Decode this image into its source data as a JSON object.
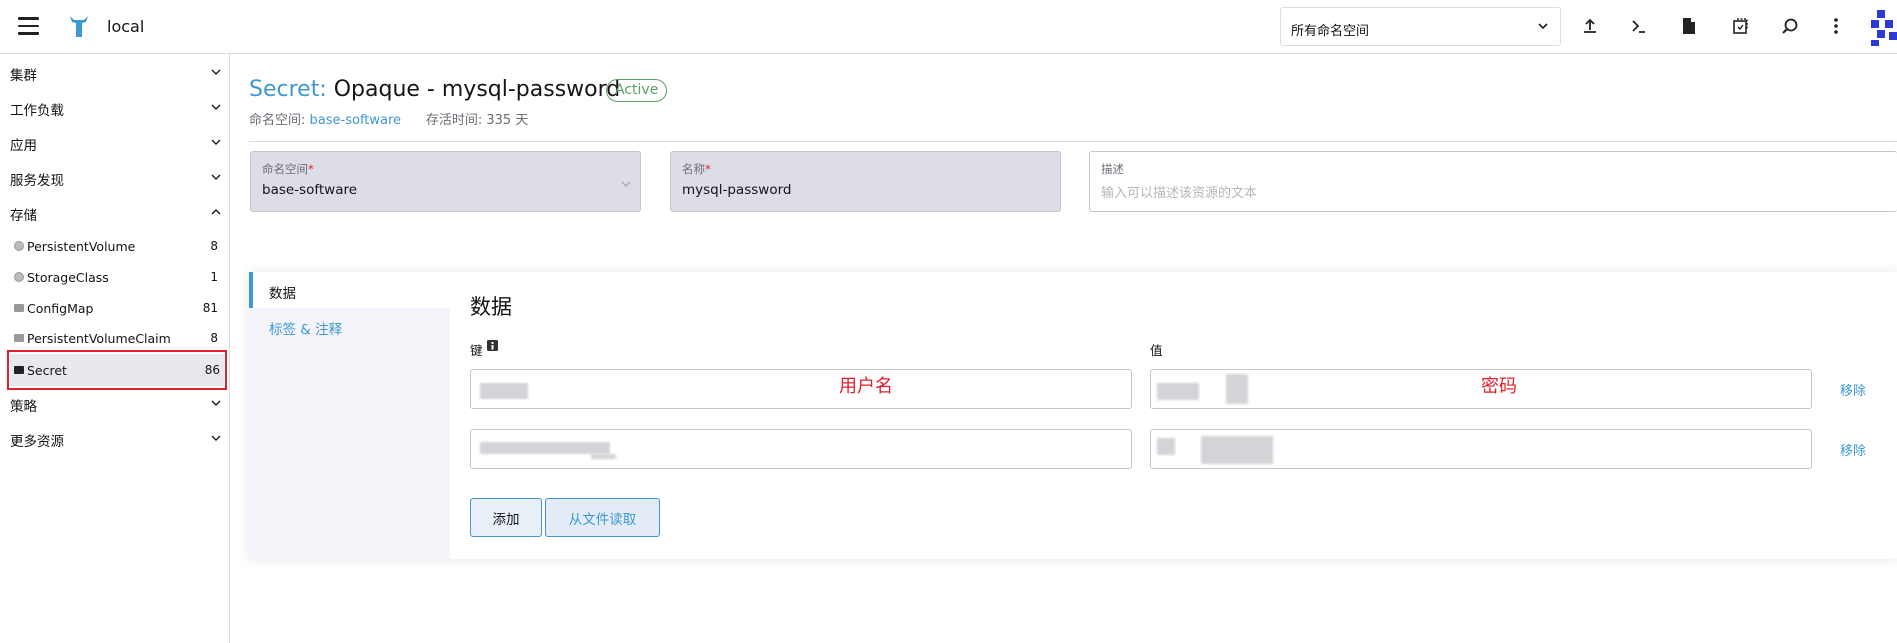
{
  "topbar": {
    "cluster_name": "local",
    "namespace_select": "所有命名空间",
    "icons": [
      "upload-icon",
      "kubectl-shell-icon",
      "file-icon",
      "copy-icon",
      "search-icon",
      "more-vert-icon"
    ]
  },
  "sidebar": {
    "groups": [
      {
        "label": "集群"
      },
      {
        "label": "工作负载"
      },
      {
        "label": "应用"
      },
      {
        "label": "服务发现"
      },
      {
        "label": "存储"
      },
      {
        "label": "策略"
      },
      {
        "label": "更多资源"
      }
    ],
    "storage_items": [
      {
        "label": "PersistentVolume",
        "count": "8"
      },
      {
        "label": "StorageClass",
        "count": "1"
      },
      {
        "label": "ConfigMap",
        "count": "81"
      },
      {
        "label": "PersistentVolumeClaim",
        "count": "8"
      },
      {
        "label": "Secret",
        "count": "86"
      }
    ]
  },
  "header": {
    "kind": "Secret:",
    "name": "Opaque - mysql-password",
    "status": "Active",
    "namespace_label": "命名空间:",
    "namespace_value": "base-software",
    "age_label": "存活时间:",
    "age_value": "335 天"
  },
  "form": {
    "namespace": {
      "label": "命名空间",
      "value": "base-software"
    },
    "name": {
      "label": "名称",
      "value": "mysql-password"
    },
    "description": {
      "label": "描述",
      "placeholder": "输入可以描述该资源的文本"
    }
  },
  "tabs": [
    {
      "label": "数据"
    },
    {
      "label": "标签 & 注释"
    }
  ],
  "data_section": {
    "title": "数据",
    "key_header": "键",
    "value_header": "值",
    "annotation_key": "用户名",
    "annotation_value": "密码",
    "remove_label": "移除",
    "add_button": "添加",
    "read_file_button": "从文件读取"
  },
  "colors": {
    "accent": "#3d98d3",
    "active_badge": "#5aa161",
    "highlight": "#e0202a"
  }
}
